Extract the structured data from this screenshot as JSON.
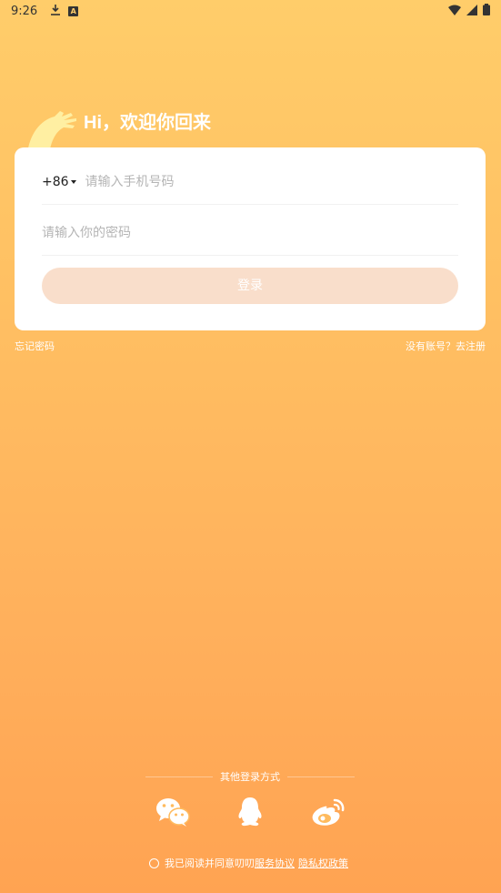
{
  "status_bar": {
    "time": "9:26"
  },
  "greeting": "Hi，欢迎你回来",
  "login_form": {
    "country_code": "+86",
    "phone_placeholder": "请输入手机号码",
    "password_placeholder": "请输入你的密码",
    "login_label": "登录"
  },
  "links": {
    "forgot": "忘记密码",
    "register": "没有账号？去注册"
  },
  "other_login": {
    "title": "其他登录方式",
    "methods": [
      "wechat-icon",
      "qq-icon",
      "weibo-icon"
    ]
  },
  "agreement": {
    "prefix": "我已阅读并同意叨叨",
    "terms": "服务协议",
    "privacy": "隐私权政策"
  },
  "colors": {
    "gradient_top": "#ffcd6a",
    "gradient_bottom": "#ffa352",
    "button_disabled": "#f9decb"
  }
}
